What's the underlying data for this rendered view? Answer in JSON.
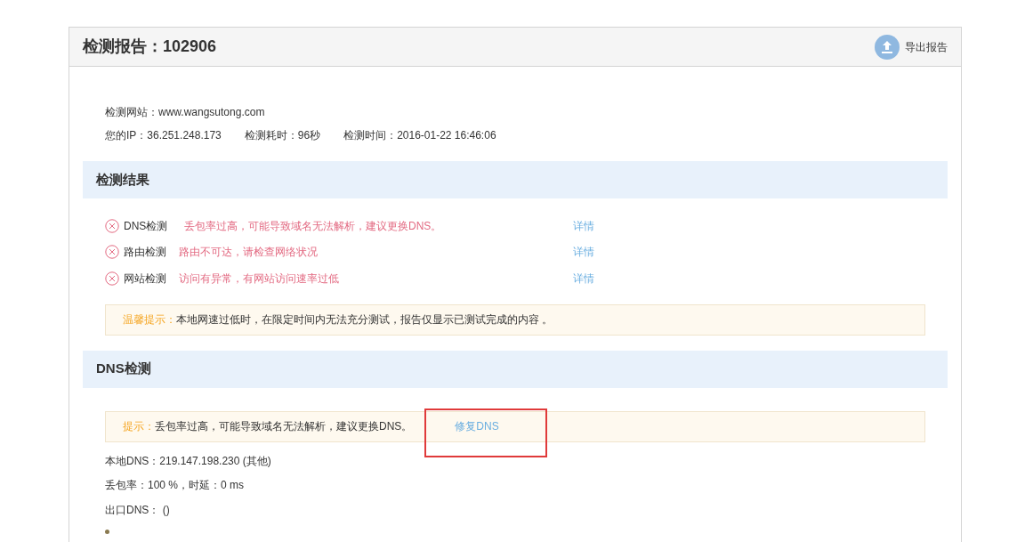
{
  "header": {
    "title": "检测报告：102906",
    "export_button": "导出报告"
  },
  "info": {
    "site": "检测网站：www.wangsutong.com",
    "meta": [
      "您的IP：36.251.248.173",
      "检测耗时：96秒",
      "检测时间：2016-01-22 16:46:06"
    ]
  },
  "results_section": {
    "title": "检测结果",
    "rows": [
      {
        "name": "DNS检测",
        "failed": true,
        "message": "丢包率过高，可能导致域名无法解析，建议更换DNS。",
        "link": "详情"
      },
      {
        "name": "路由检测",
        "failed": true,
        "message": "路由不可达，请检查网络状况",
        "link": "详情"
      },
      {
        "name": "网站检测",
        "failed": true,
        "message": "访问有异常，有网站访问速率过低",
        "link": "详情"
      }
    ],
    "notice": {
      "label": "温馨提示：",
      "text": "本地网速过低时，在限定时间内无法充分测试，报告仅显示已测试完成的内容 。"
    }
  },
  "dns_section": {
    "title": "DNS检测",
    "notice": {
      "label": "提示：",
      "text": "丢包率过高，可能导致域名无法解析，建议更换DNS。",
      "link": "修复DNS"
    },
    "lines": [
      "本地DNS：219.147.198.230 (其他)",
      "丢包率：100 %，时延：0 ms",
      "出口DNS： ()"
    ]
  }
}
